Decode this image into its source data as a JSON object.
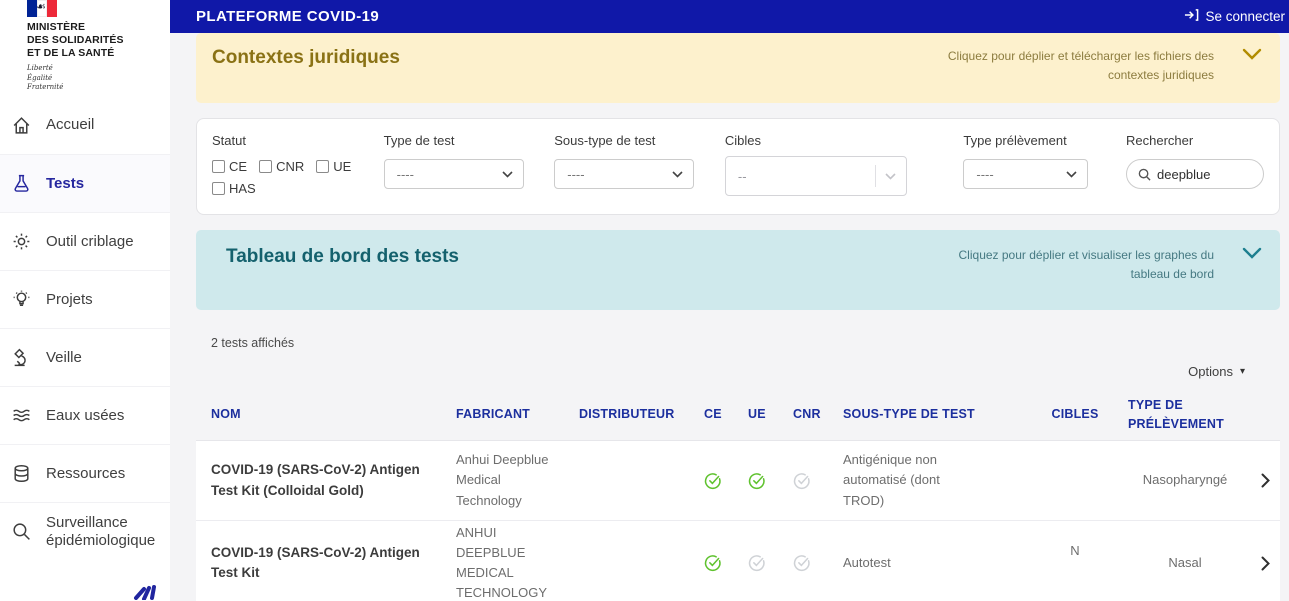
{
  "brand": {
    "ministry_lines": [
      "MINISTÈRE",
      "DES SOLIDARITÉS",
      "ET DE LA SANTÉ"
    ],
    "motto_lines": [
      "Liberté",
      "Égalité",
      "Fraternité"
    ]
  },
  "header": {
    "title": "PLATEFORME COVID-19",
    "login_label": "Se connecter"
  },
  "sidebar": {
    "items": [
      {
        "label": "Accueil",
        "icon": "home-icon",
        "active": false
      },
      {
        "label": "Tests",
        "icon": "flask-icon",
        "active": true
      },
      {
        "label": "Outil criblage",
        "icon": "gear-icon",
        "active": false
      },
      {
        "label": "Projets",
        "icon": "lightbulb-icon",
        "active": false
      },
      {
        "label": "Veille",
        "icon": "microscope-icon",
        "active": false
      },
      {
        "label": "Eaux usées",
        "icon": "waves-icon",
        "active": false
      },
      {
        "label": "Ressources",
        "icon": "database-icon",
        "active": false
      },
      {
        "label": "Surveillance épidémiologique",
        "icon": "magnifier-icon",
        "active": false
      }
    ]
  },
  "legal_banner": {
    "title": "Contextes juridiques",
    "hint": "Cliquez pour déplier et télécharger les fichiers des contextes juridiques"
  },
  "filters": {
    "statut": {
      "label": "Statut",
      "options": [
        "CE",
        "CNR",
        "UE",
        "HAS"
      ],
      "checked": []
    },
    "type_test": {
      "label": "Type de test",
      "value": "----"
    },
    "sous_type": {
      "label": "Sous-type de test",
      "value": "----"
    },
    "cibles": {
      "label": "Cibles",
      "value": "--"
    },
    "type_prelevement": {
      "label": "Type prélèvement",
      "value": "----"
    },
    "search": {
      "label": "Rechercher",
      "value": "deepblue"
    }
  },
  "dashboard_banner": {
    "title": "Tableau de bord des tests",
    "hint": "Cliquez pour déplier et visualiser les graphes du tableau de bord"
  },
  "results": {
    "count_text": "2 tests affichés",
    "options_label": "Options"
  },
  "table": {
    "headers": [
      "NOM",
      "FABRICANT",
      "DISTRIBUTEUR",
      "CE",
      "UE",
      "CNR",
      "SOUS-TYPE DE TEST",
      "CIBLES",
      "TYPE DE PRÉLÈVEMENT"
    ],
    "rows": [
      {
        "nom": "COVID-19 (SARS-CoV-2) Antigen Test Kit (Colloidal Gold)",
        "fabricant": "Anhui Deepblue Medical Technology",
        "distributeur": "",
        "ce": "checked",
        "ue": "checked",
        "cnr": "unchecked",
        "sous_type": "Antigénique non automatisé (dont TROD)",
        "cibles": "",
        "prelevement": "Nasopharyngé"
      },
      {
        "nom": "COVID-19 (SARS-CoV-2) Antigen Test Kit",
        "fabricant": "ANHUI DEEPBLUE MEDICAL TECHNOLOGY",
        "distributeur": "",
        "ce": "checked",
        "ue": "unchecked",
        "cnr": "unchecked",
        "sous_type": "Autotest",
        "cibles": "N",
        "prelevement": "Nasal"
      }
    ]
  },
  "colors": {
    "header_bar": "#1018a8",
    "sidebar_active": "#26279f",
    "yellow_banner_bg": "#fdf1cd",
    "yellow_banner_text": "#8a7215",
    "teal_banner_bg": "#cfe9ec",
    "teal_banner_text": "#14616d",
    "table_header_text": "#1c2f9e",
    "check_green": "#5fc22e",
    "check_gray": "#cfd2d6"
  }
}
